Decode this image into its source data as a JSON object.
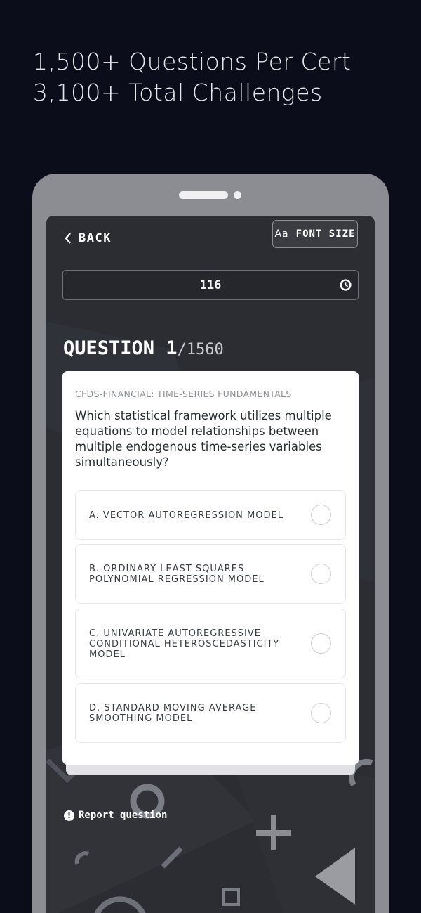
{
  "promo": {
    "line1": "1,500+ Questions Per Cert",
    "line2": "3,100+ Total Challenges"
  },
  "toolbar": {
    "back_label": "BACK",
    "font_size_icon_text": "Aa",
    "font_size_label": "FONT SIZE"
  },
  "timer": {
    "value": "116"
  },
  "question": {
    "prefix": "QUESTION 1",
    "total": "/1560",
    "category": "CFDS-FINANCIAL: TIME-SERIES FUNDAMENTALS",
    "text": "Which statistical framework utilizes multiple equations to model relationships between multiple endogenous time-series variables simultaneously?",
    "options": [
      {
        "label": "A. VECTOR AUTOREGRESSION MODEL",
        "selected": false
      },
      {
        "label": "B. ORDINARY LEAST SQUARES POLYNOMIAL REGRESSION MODEL",
        "selected": false
      },
      {
        "label": "C. UNIVARIATE AUTOREGRESSIVE CONDITIONAL HETEROSCEDASTICITY MODEL",
        "selected": false
      },
      {
        "label": "D. STANDARD MOVING AVERAGE SMOOTHING MODEL",
        "selected": false
      }
    ]
  },
  "report": {
    "icon_text": "!",
    "label": "Report question"
  },
  "colors": {
    "page_background": "#0b0e1a",
    "phone_frame": "#8b8d93",
    "screen_background": "#2b2d33",
    "card_background": "#ffffff"
  }
}
